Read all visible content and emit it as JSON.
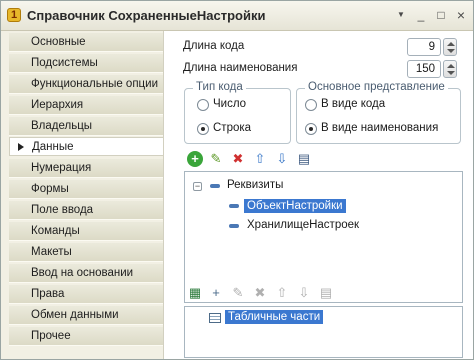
{
  "window": {
    "title": "Справочник СохраненныеНастройки",
    "app_icon_glyph": "1",
    "controls": {
      "menu": "▼",
      "minimize": "_",
      "maximize": "□",
      "close": "×"
    }
  },
  "sidebar": {
    "items": [
      {
        "label": "Основные"
      },
      {
        "label": "Подсистемы"
      },
      {
        "label": "Функциональные опции"
      },
      {
        "label": "Иерархия"
      },
      {
        "label": "Владельцы"
      },
      {
        "label": "Данные",
        "active": true
      },
      {
        "label": "Нумерация"
      },
      {
        "label": "Формы"
      },
      {
        "label": "Поле ввода"
      },
      {
        "label": "Команды"
      },
      {
        "label": "Макеты"
      },
      {
        "label": "Ввод на основании"
      },
      {
        "label": "Права"
      },
      {
        "label": "Обмен данными"
      },
      {
        "label": "Прочее"
      }
    ]
  },
  "main": {
    "code_length": {
      "label": "Длина кода",
      "value": "9"
    },
    "name_length": {
      "label": "Длина наименования",
      "value": "150"
    },
    "code_type": {
      "title": "Тип кода",
      "options": [
        {
          "label": "Число",
          "checked": false
        },
        {
          "label": "Строка",
          "checked": true
        }
      ]
    },
    "main_view": {
      "title": "Основное представление",
      "options": [
        {
          "label": "В виде кода",
          "checked": false
        },
        {
          "label": "В виде наименования",
          "checked": true
        }
      ]
    },
    "toolbar1_icons": [
      "add-icon",
      "edit-icon",
      "delete-icon",
      "move-up-icon",
      "move-down-icon",
      "sort-icon"
    ],
    "toolbar1_glyphs": {
      "add": "+",
      "edit": "✎",
      "delete": "✖",
      "up": "⇧",
      "down": "⇩",
      "list": "▤"
    },
    "attributes_tree": {
      "root": "Реквизиты",
      "collapse_glyph": "−",
      "children": [
        {
          "label": "ОбъектНастройки",
          "selected": true
        },
        {
          "label": "ХранилищеНастроек",
          "selected": false
        }
      ]
    },
    "toolbar2_icons": [
      "add-table-icon",
      "add-attribute-icon",
      "edit-icon",
      "delete-icon",
      "move-up-icon",
      "move-down-icon",
      "sort-icon"
    ],
    "toolbar2_glyphs": {
      "add_table": "▦",
      "add_attr": "+",
      "edit": "✎",
      "delete": "✖",
      "up": "⇧",
      "down": "⇩",
      "list": "▤"
    },
    "tabular_tree": {
      "root": "Табличные части",
      "selected": true
    }
  },
  "colors": {
    "accent_selection": "#3b78d0",
    "group_title": "#4a5c70",
    "sidebar_bg": "#e6e4d3"
  }
}
